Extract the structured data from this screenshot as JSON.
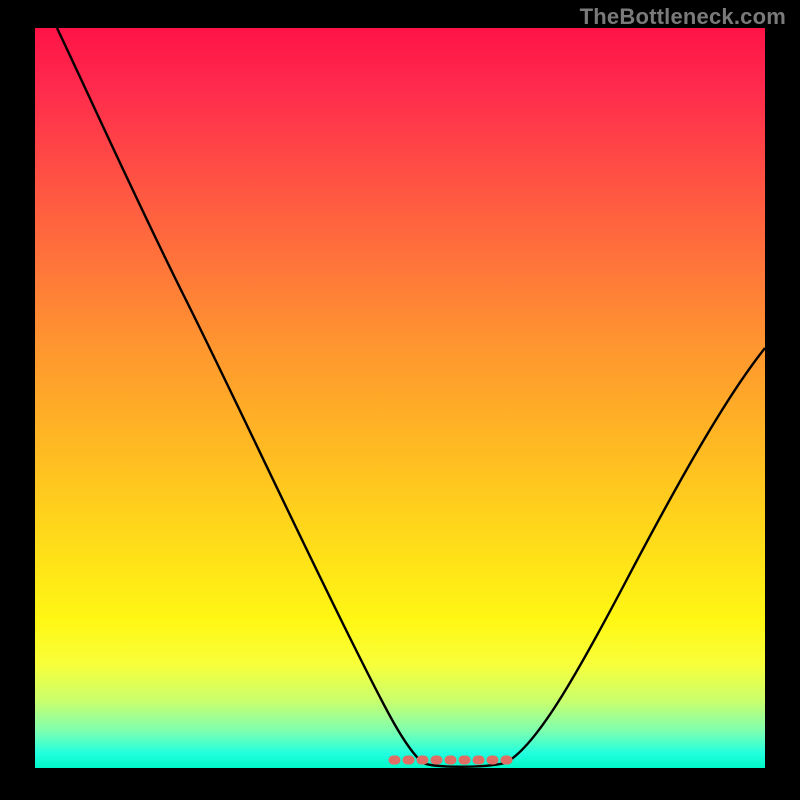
{
  "watermark": "TheBottleneck.com",
  "chart_data": {
    "type": "line",
    "title": "",
    "xlabel": "",
    "ylabel": "",
    "xlim": [
      0,
      1
    ],
    "ylim": [
      0,
      1
    ],
    "gradient_direction": "vertical",
    "gradient_stops": [
      {
        "pos": 0.0,
        "color": "#ff1347"
      },
      {
        "pos": 0.08,
        "color": "#ff2a4d"
      },
      {
        "pos": 0.18,
        "color": "#ff4a45"
      },
      {
        "pos": 0.3,
        "color": "#ff6f3c"
      },
      {
        "pos": 0.42,
        "color": "#ff9330"
      },
      {
        "pos": 0.55,
        "color": "#ffb524"
      },
      {
        "pos": 0.68,
        "color": "#ffd81a"
      },
      {
        "pos": 0.8,
        "color": "#fff714"
      },
      {
        "pos": 0.86,
        "color": "#f8ff3a"
      },
      {
        "pos": 0.91,
        "color": "#c8ff6e"
      },
      {
        "pos": 0.95,
        "color": "#7dffb0"
      },
      {
        "pos": 0.98,
        "color": "#22ffdf"
      },
      {
        "pos": 1.0,
        "color": "#00f7c9"
      }
    ],
    "series": [
      {
        "name": "bottleneck-curve",
        "x": [
          0.03,
          0.1,
          0.2,
          0.3,
          0.4,
          0.48,
          0.53,
          0.58,
          0.64,
          0.7,
          0.8,
          0.9,
          1.0
        ],
        "y": [
          1.0,
          0.85,
          0.67,
          0.5,
          0.32,
          0.14,
          0.03,
          0.0,
          0.02,
          0.1,
          0.26,
          0.42,
          0.57
        ]
      }
    ],
    "flat_zone": {
      "x_start": 0.49,
      "x_end": 0.66,
      "y": 0.01,
      "color": "#df6e64"
    }
  }
}
